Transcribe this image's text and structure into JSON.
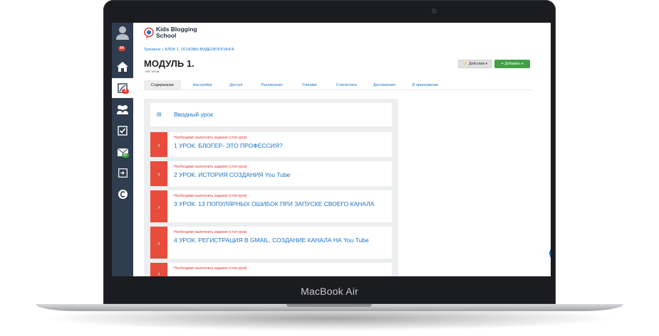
{
  "device": {
    "label": "MacBook Air"
  },
  "sidebar": {
    "badges": {
      "profile": "64",
      "dashboard": "9",
      "messages": "27"
    },
    "icons": [
      "user-icon",
      "home-icon",
      "dashboard-icon",
      "people-icon",
      "checkbox-icon",
      "mail-icon",
      "login-icon",
      "support-icon"
    ]
  },
  "header": {
    "logo_line1": "Kids Blogging",
    "logo_line2": "School",
    "breadcrumb": "Тренинги » БЛОК 1. ОСНОВЫ ВИДЕОБЛОГИНГА",
    "title": "МОДУЛЬ 1.",
    "subtitle": "нет тегов",
    "actions_label": "Действия ▾",
    "add_label": "Добавить ▾"
  },
  "tabs": [
    "Содержание",
    "Настройки",
    "Доступ",
    "Расписание",
    "Ученики",
    "Статистика",
    "Достижения",
    "В приложении"
  ],
  "lessons": {
    "intro": "Вводный урок",
    "stop_label": "Необходимо выполнить задание (стоп-урок)",
    "items": [
      "1 УРОК. БЛОГЕР- ЭТО ПРОФЕССИЯ?",
      "2 УРОК. ИСТОРИЯ СОЗДАНИЯ You Tube",
      "3 УРОК. 13 ПОПУЛЯРНЫХ ОШИБОК ПРИ ЗАПУСКЕ СВОЕГО КАНАЛА",
      "4 УРОК. РЕГИСТРАЦИЯ В GMAIL, СОЗДАНИЕ КАНАЛА НА You Tube"
    ]
  },
  "colors": {
    "accent": "#1c73c4",
    "stop": "#e84c3d",
    "sidebar": "#2f3d4f",
    "add": "#43a047"
  }
}
